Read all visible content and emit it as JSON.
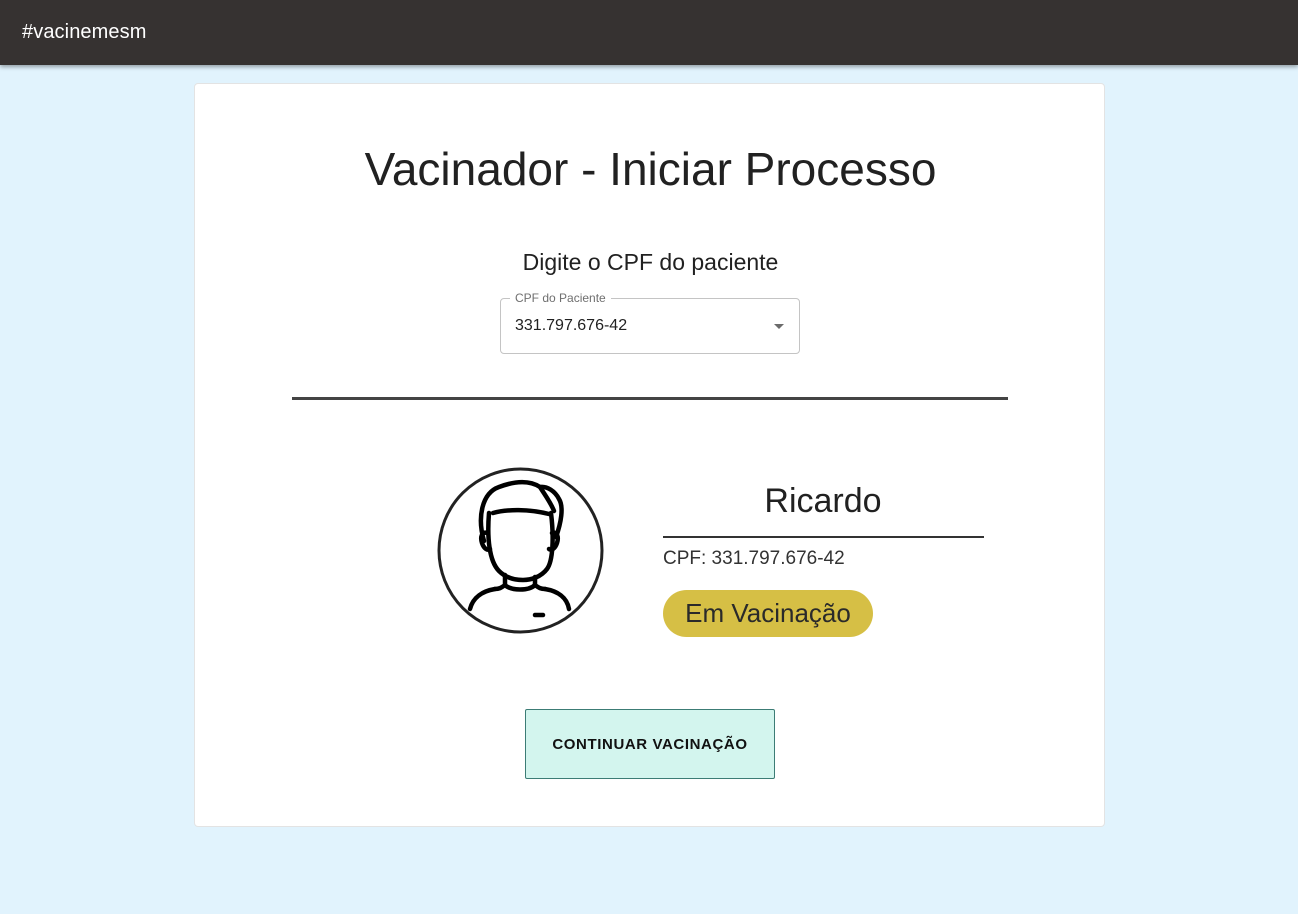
{
  "appbar": {
    "brand": "#vacinemesm"
  },
  "page": {
    "title": "Vacinador - Iniciar Processo",
    "subtitle": "Digite o CPF do paciente"
  },
  "cpf_select": {
    "label": "CPF do Paciente",
    "value": "331.797.676-42",
    "icon": "arrow-drop-down-icon"
  },
  "patient": {
    "avatar_icon": "user-avatar-icon",
    "name": "Ricardo",
    "cpf_text": "CPF: 331.797.676-42",
    "status": "Em Vacinação"
  },
  "actions": {
    "continue_label": "CONTINUAR VACINAÇÃO"
  },
  "colors": {
    "appbar": "#363231",
    "background": "#e1f3fd",
    "status_badge": "#d6bf45",
    "continue_button": "#d3f5ee"
  }
}
